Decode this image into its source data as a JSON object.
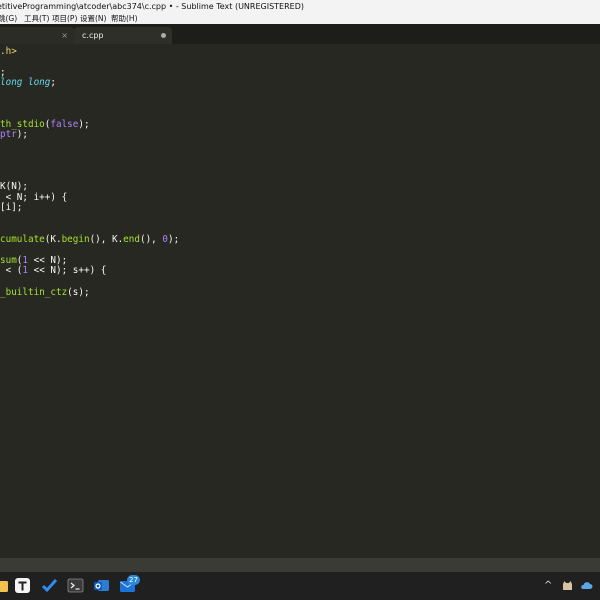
{
  "window": {
    "title": "etitiveProgramming\\atcoder\\abc374\\c.cpp • - Sublime Text (UNREGISTERED)"
  },
  "menu": {
    "items": [
      "跳(G)",
      "工具(T)",
      "项目(P)",
      "设置(N)",
      "帮助(H)"
    ]
  },
  "tabs": [
    {
      "label": "",
      "close": "×"
    },
    {
      "label": "c.cpp",
      "modified": true
    }
  ],
  "editor": {
    "lines": [
      ".h>",
      "",
      ";",
      "long long;",
      "",
      "",
      "",
      "th_stdio(false);",
      "ptr);",
      "",
      "",
      "",
      "",
      "K(N);",
      " < N; i++) {",
      "[i];",
      "",
      "",
      "cumulate(K.begin(), K.end(), 0);",
      "",
      "sum(1 << N);",
      " < (1 << N); s++) {",
      "",
      "_builtin_ctz(s);"
    ]
  },
  "taskbar": {
    "badge_count": "27"
  },
  "colors": {
    "bg": "#272822",
    "keyword": "#66d9ef",
    "function": "#a6e22e",
    "number": "#ae81ff",
    "string": "#e6db74"
  }
}
